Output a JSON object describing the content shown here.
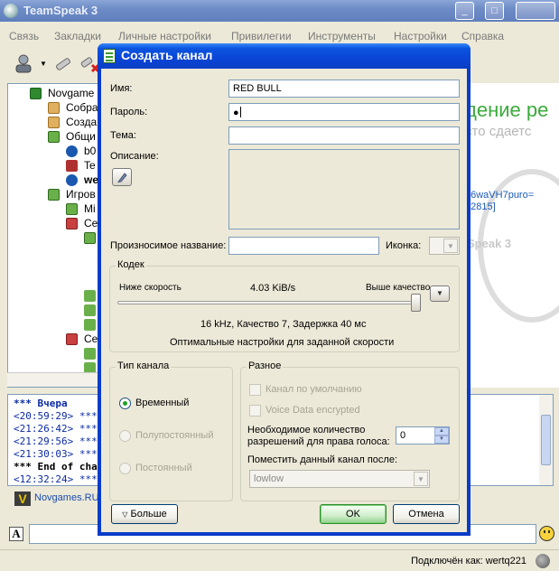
{
  "window": {
    "title": "TeamSpeak 3",
    "menu": [
      "Связь",
      "Закладки",
      "Личные настройки",
      "Привилегии",
      "Инструменты",
      "Настройки",
      "Справка"
    ]
  },
  "tree": {
    "items": [
      {
        "text": "Novgame",
        "color": "#2f8a2f"
      },
      {
        "text": "Собра",
        "color": "#d8a040"
      },
      {
        "text": "Созда",
        "color": "#d8a040"
      },
      {
        "text": "Общи",
        "color": "#2f8a2f"
      },
      {
        "text": "b0",
        "color": "#1a58b0"
      },
      {
        "text": "Te",
        "color": "#b03030"
      },
      {
        "text": "we",
        "color": "#1a58b0"
      },
      {
        "text": "Игров",
        "color": "#2f8a2f"
      },
      {
        "text": "Mi",
        "color": "#2f8a2f"
      },
      {
        "text": "Се",
        "color": "#b03030"
      },
      {
        "text": "Се",
        "color": "#2f8a2f"
      },
      {
        "text": "Се",
        "color": "#b03030"
      }
    ]
  },
  "right_panel": {
    "ad_line1": "дение ре",
    "ad_line2": "сто сдаетс",
    "text1": "56waVH7puro=",
    "text2": "12815]",
    "brand": "Speak 3"
  },
  "chat": {
    "lines": [
      "*** Вчера",
      "<20:59:29> *** T",
      "<21:26:42> *** T",
      "<21:29:56> *** T",
      "<21:30:03> *** T",
      "*** End of chat h",
      "<12:32:24> *** T"
    ]
  },
  "server_tab": {
    "label": "Novgames.RU"
  },
  "status": {
    "connected_as": "Подключён как: wertq221"
  },
  "dialog": {
    "title": "Создать канал",
    "name_label": "Имя:",
    "name_value": "RED BULL",
    "password_label": "Пароль:",
    "password_value": "●",
    "topic_label": "Тема:",
    "topic_value": "",
    "description_label": "Описание:",
    "phonetic_label": "Произносимое название:",
    "phonetic_value": "",
    "icon_label": "Иконка:",
    "codec": {
      "title": "Кодек",
      "low_label": "Ниже скорость",
      "speed": "4.03 KiB/s",
      "high_label": "Выше качество",
      "slider_level": 1.0,
      "info": "16 kHz, Качество 7, Задержка 40 мс",
      "hint": "Оптимальные настройки для заданной скорости"
    },
    "channel_type": {
      "title": "Тип канала",
      "options": [
        "Временный",
        "Полупостоянный",
        "Постоянный"
      ],
      "selected": "Временный"
    },
    "misc": {
      "title": "Разное",
      "default_channel": "Канал по умолчанию",
      "voice_encrypted": "Voice Data encrypted",
      "talk_power_label_1": "Необходимое количество",
      "talk_power_label_2": "разрешений для права голоса:",
      "talk_power_value": "0",
      "sort_after_label": "Поместить данный канал после:",
      "sort_after_value": "lowlow"
    },
    "more_button": "Больше",
    "ok_button": "OK",
    "cancel_button": "Отмена"
  }
}
